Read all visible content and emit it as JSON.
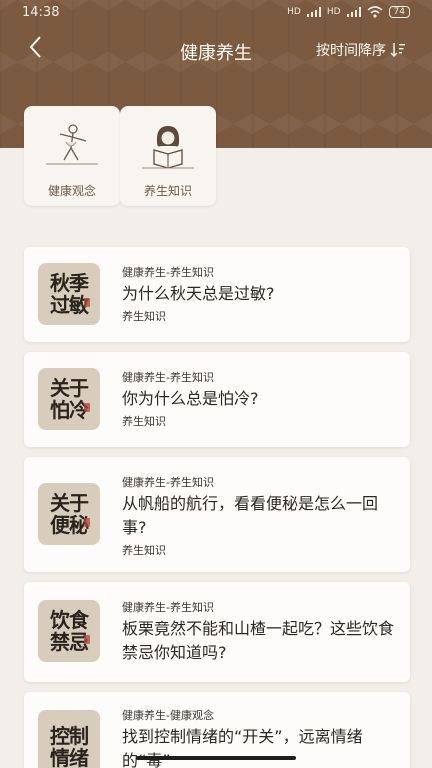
{
  "status": {
    "time": "14:38",
    "net1": "HD",
    "net2": "HD",
    "battery": "74"
  },
  "nav": {
    "back_glyph": "‹",
    "title": "健康养生",
    "sort_label": "按时间降序",
    "sort_icon": "sort-icon"
  },
  "categories": [
    {
      "label": "健康观念",
      "icon": "taichi-person-icon"
    },
    {
      "label": "养生知识",
      "icon": "reading-person-icon"
    }
  ],
  "articles": [
    {
      "thumb": "秋季\n过敏",
      "category": "健康养生-养生知识",
      "title": "为什么秋天总是过敏?",
      "tag": "养生知识"
    },
    {
      "thumb": "关于\n怕冷",
      "category": "健康养生-养生知识",
      "title": "你为什么总是怕冷?",
      "tag": "养生知识"
    },
    {
      "thumb": "关于\n便秘",
      "category": "健康养生-养生知识",
      "title": "从帆船的航行，看看便秘是怎么一回事?",
      "tag": "养生知识"
    },
    {
      "thumb": "饮食\n禁忌",
      "category": "健康养生-养生知识",
      "title": "板栗竟然不能和山楂一起吃？这些饮食禁忌你知道吗?",
      "tag": ""
    },
    {
      "thumb": "控制\n情绪",
      "category": "健康养生-健康观念",
      "title": "找到控制情绪的“开关”，远离情绪的“毒”",
      "tag": ""
    }
  ],
  "colors": {
    "header": "#7b5a3f",
    "background": "#f2efea",
    "seal": "#b4463a"
  }
}
